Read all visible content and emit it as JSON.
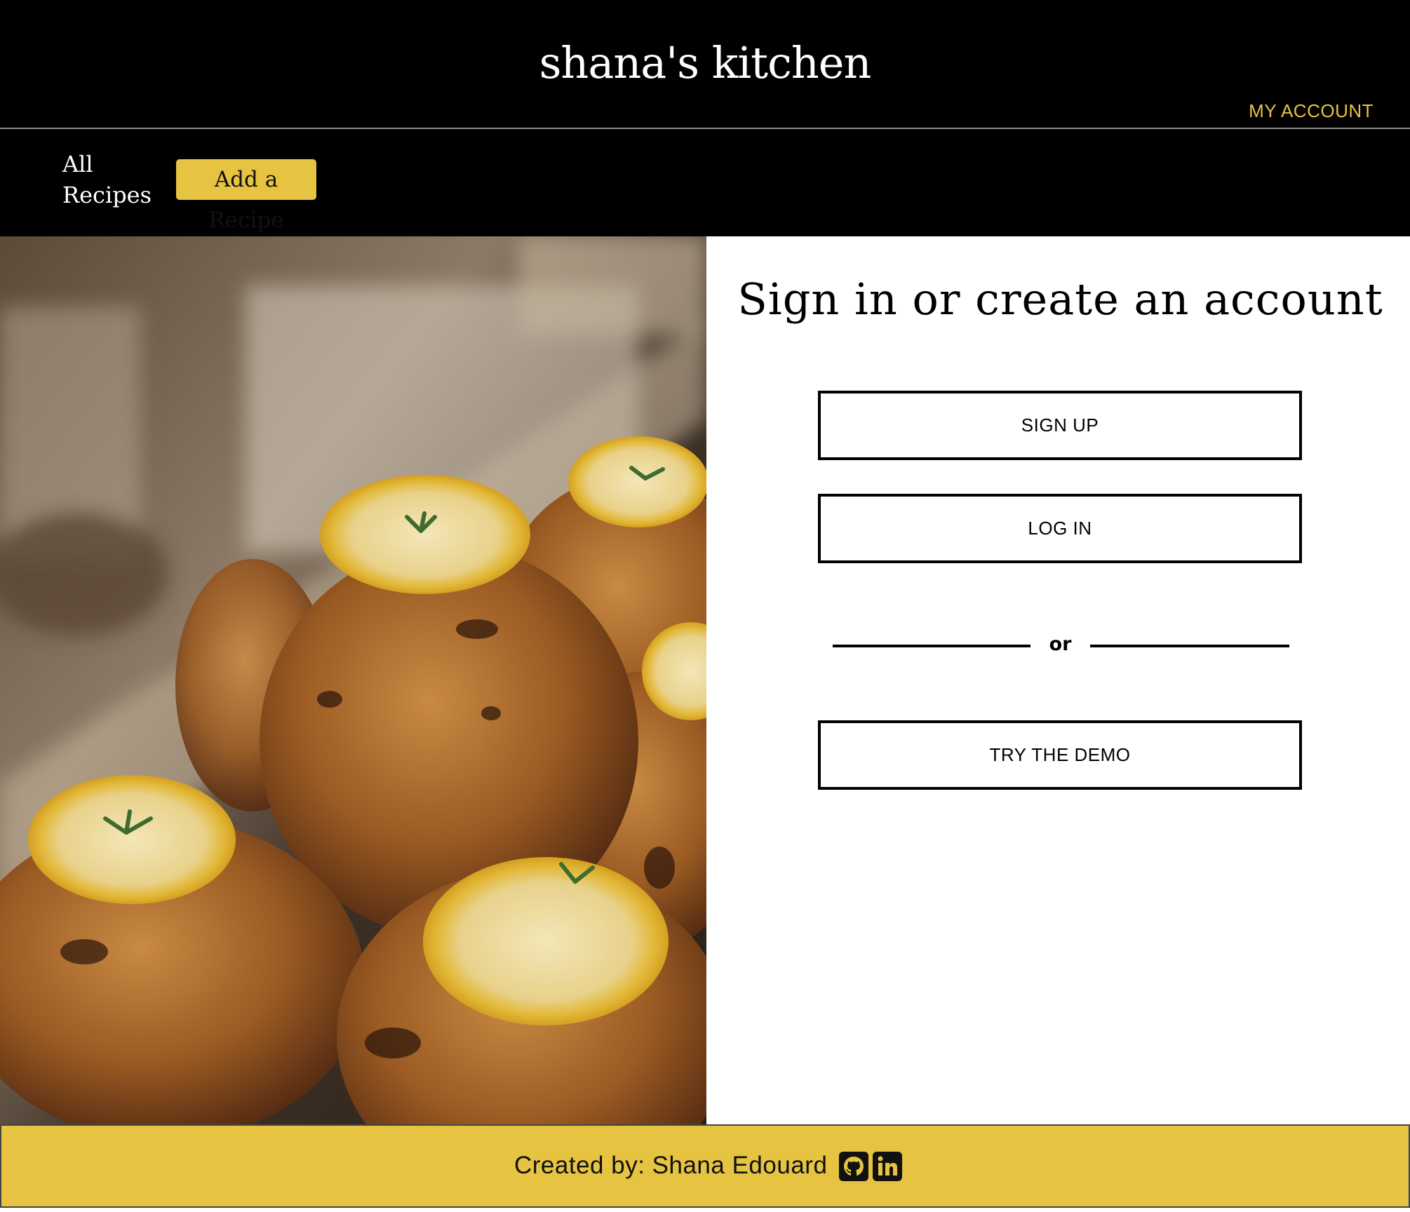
{
  "header": {
    "site_title": "shana's kitchen",
    "account_link": "MY ACCOUNT"
  },
  "nav": {
    "all_recipes": "All Recipes",
    "add_recipe": "Add a Recipe"
  },
  "hero": {
    "image_icon": "food-photo"
  },
  "auth": {
    "title": "Sign in or create an account",
    "sign_up": "SIGN UP",
    "log_in": "LOG IN",
    "divider_text": "or",
    "demo": "TRY THE DEMO"
  },
  "footer": {
    "credit": "Created by: Shana Edouard",
    "icons": [
      "github-icon",
      "linkedin-icon"
    ]
  },
  "colors": {
    "header_bg": "#000000",
    "accent": "#e6c341",
    "panel_bg": "#ffffff",
    "text_dark": "#000000"
  }
}
